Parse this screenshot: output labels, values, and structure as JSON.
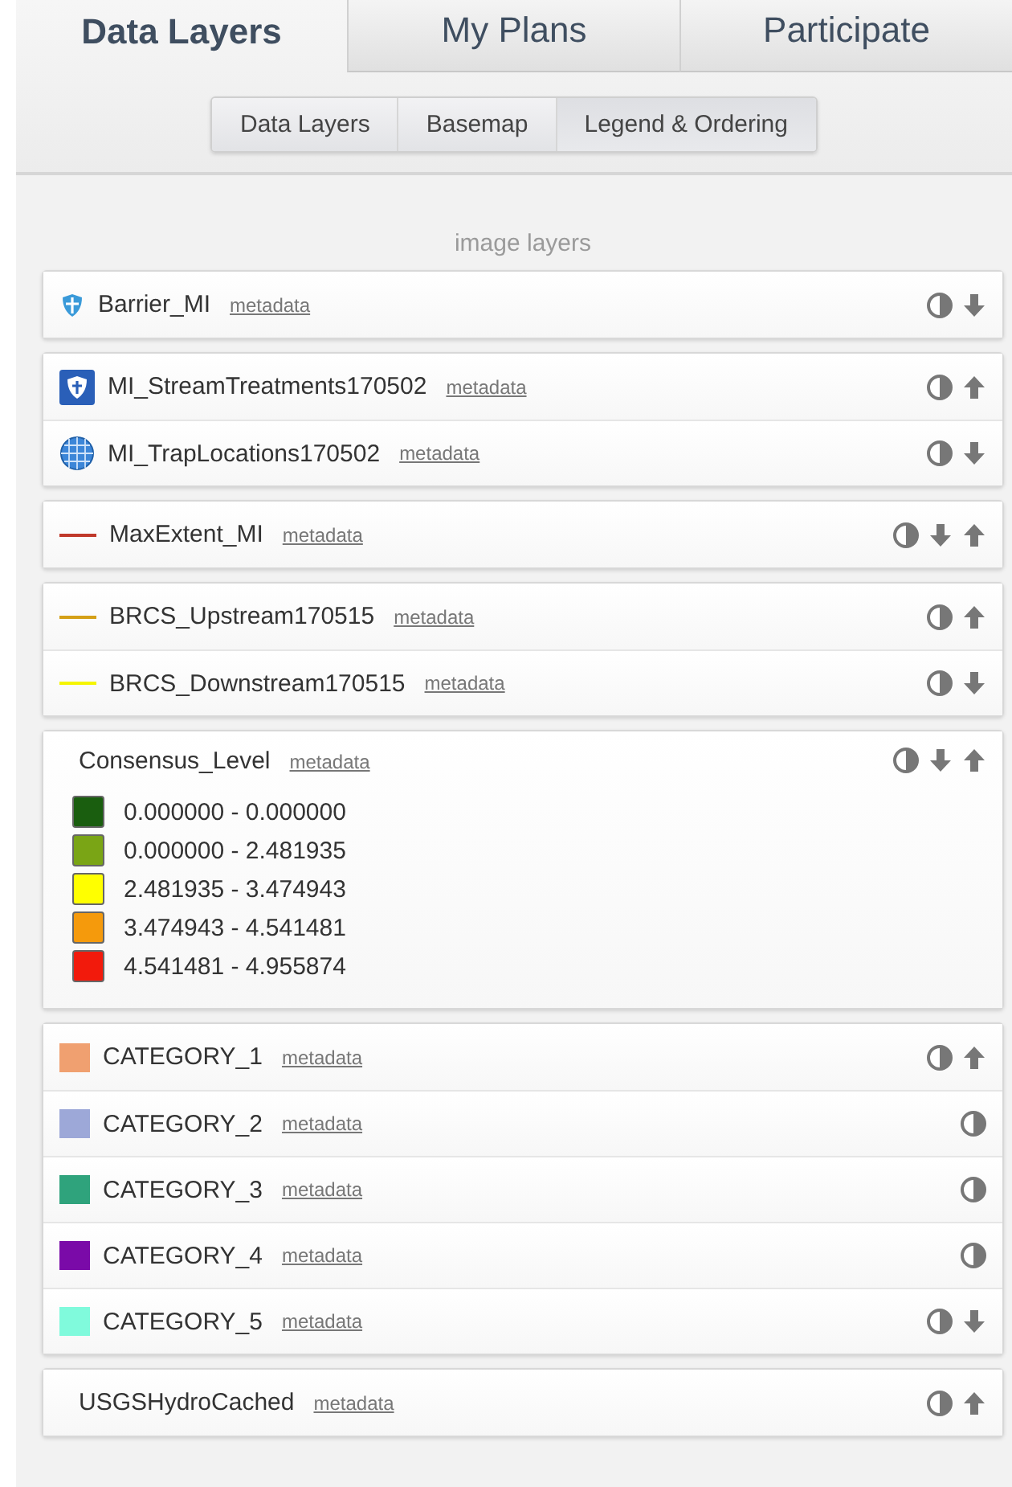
{
  "main_tabs": [
    {
      "label": "Data Layers",
      "selected": true
    },
    {
      "label": "My Plans",
      "selected": false
    },
    {
      "label": "Participate",
      "selected": false
    }
  ],
  "sub_tabs": [
    {
      "label": "Data Layers",
      "selected": false
    },
    {
      "label": "Basemap",
      "selected": false
    },
    {
      "label": "Legend & Ordering",
      "selected": true
    }
  ],
  "section_label": "image layers",
  "groups": [
    {
      "layers": [
        {
          "name": "Barrier_MI",
          "symbol": {
            "kind": "shield"
          },
          "metadata": "metadata",
          "down": true,
          "up": false
        }
      ]
    },
    {
      "layers": [
        {
          "name": "MI_StreamTreatments170502",
          "symbol": {
            "kind": "badge"
          },
          "metadata": "metadata",
          "down": false,
          "up": true
        },
        {
          "name": "MI_TrapLocations170502",
          "symbol": {
            "kind": "globe"
          },
          "metadata": "metadata",
          "down": true,
          "up": false
        }
      ]
    },
    {
      "layers": [
        {
          "name": "MaxExtent_MI",
          "symbol": {
            "kind": "line",
            "color": "#c0392b"
          },
          "metadata": "metadata",
          "down": true,
          "up": true
        }
      ]
    },
    {
      "layers": [
        {
          "name": "BRCS_Upstream170515",
          "symbol": {
            "kind": "line",
            "color": "#d4a017"
          },
          "metadata": "metadata",
          "down": false,
          "up": true
        },
        {
          "name": "BRCS_Downstream170515",
          "symbol": {
            "kind": "line",
            "color": "#f5f500"
          },
          "metadata": "metadata",
          "down": true,
          "up": false
        }
      ]
    },
    {
      "layers": [
        {
          "name": "Consensus_Level",
          "symbol": {
            "kind": "none"
          },
          "metadata": "metadata",
          "down": true,
          "up": true,
          "legend": [
            {
              "label": "0.000000 - 0.000000",
              "color": "#1a5e0f"
            },
            {
              "label": "0.000000 - 2.481935",
              "color": "#7aa515"
            },
            {
              "label": "2.481935 - 3.474943",
              "color": "#ffff00"
            },
            {
              "label": "3.474943 - 4.541481",
              "color": "#f59a0c"
            },
            {
              "label": "4.541481 - 4.955874",
              "color": "#f21a0c"
            }
          ]
        }
      ]
    },
    {
      "layers": [
        {
          "name": "CATEGORY_1",
          "symbol": {
            "kind": "swatch",
            "color": "#f0a070"
          },
          "metadata": "metadata",
          "down": false,
          "up": true
        },
        {
          "name": "CATEGORY_2",
          "symbol": {
            "kind": "swatch",
            "color": "#9da8d8"
          },
          "metadata": "metadata",
          "down": false,
          "up": false
        },
        {
          "name": "CATEGORY_3",
          "symbol": {
            "kind": "swatch",
            "color": "#2fa37c"
          },
          "metadata": "metadata",
          "down": false,
          "up": false
        },
        {
          "name": "CATEGORY_4",
          "symbol": {
            "kind": "swatch",
            "color": "#7a0aa8"
          },
          "metadata": "metadata",
          "down": false,
          "up": false
        },
        {
          "name": "CATEGORY_5",
          "symbol": {
            "kind": "swatch",
            "color": "#80fadc"
          },
          "metadata": "metadata",
          "down": true,
          "up": false
        }
      ]
    },
    {
      "layers": [
        {
          "name": "USGSHydroCached",
          "symbol": {
            "kind": "none"
          },
          "metadata": "metadata",
          "down": false,
          "up": true
        }
      ]
    }
  ]
}
